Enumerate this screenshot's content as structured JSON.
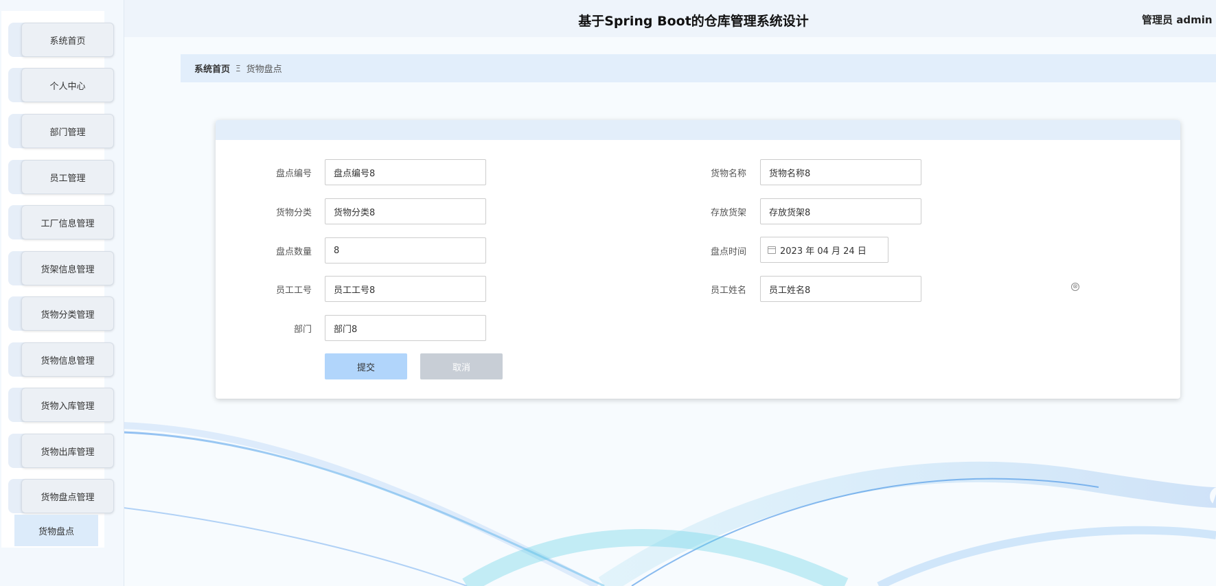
{
  "header": {
    "title": "基于Spring Boot的仓库管理系统设计",
    "user": "管理员 admin"
  },
  "sidebar": {
    "items": [
      {
        "label": "系统首页"
      },
      {
        "label": "个人中心"
      },
      {
        "label": "部门管理"
      },
      {
        "label": "员工管理"
      },
      {
        "label": "工厂信息管理"
      },
      {
        "label": "货架信息管理"
      },
      {
        "label": "货物分类管理"
      },
      {
        "label": "货物信息管理"
      },
      {
        "label": "货物入库管理"
      },
      {
        "label": "货物出库管理"
      },
      {
        "label": "货物盘点管理"
      }
    ],
    "submenu": {
      "label": "货物盘点"
    }
  },
  "breadcrumb": {
    "home": "系统首页",
    "separator": "Ξ",
    "current": "货物盘点"
  },
  "form": {
    "inventory_no": {
      "label": "盘点编号",
      "value": "盘点编号8"
    },
    "goods_name": {
      "label": "货物名称",
      "value": "货物名称8"
    },
    "goods_category": {
      "label": "货物分类",
      "value": "货物分类8"
    },
    "shelf": {
      "label": "存放货架",
      "value": "存放货架8"
    },
    "quantity": {
      "label": "盘点数量",
      "value": "8"
    },
    "check_time": {
      "label": "盘点时间",
      "value": "2023 年 04 月 24 日"
    },
    "employee_no": {
      "label": "员工工号",
      "value": "员工工号8"
    },
    "employee_name": {
      "label": "员工姓名",
      "value": "员工姓名8"
    },
    "department": {
      "label": "部门",
      "value": "部门8"
    },
    "submit_label": "提交",
    "cancel_label": "取消",
    "clear_icon": "⊗"
  },
  "colors": {
    "accent": "#b1d5fb",
    "breadcrumb_bg": "#e2eefb",
    "header_bg": "#eef4fb",
    "cancel_bg": "#c8ced6"
  }
}
